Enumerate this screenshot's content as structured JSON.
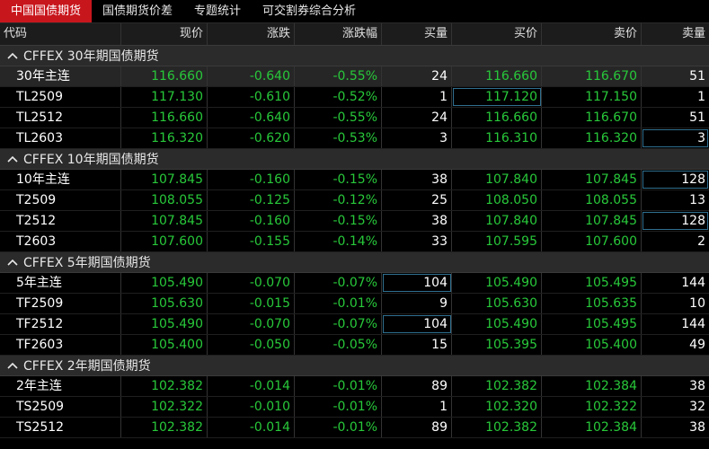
{
  "tabs": [
    "中国国债期货",
    "国债期货价差",
    "专题统计",
    "可交割券综合分析"
  ],
  "columns": [
    "代码",
    "现价",
    "涨跌",
    "涨跌幅",
    "买量",
    "买价",
    "卖价",
    "卖量"
  ],
  "groups": [
    {
      "title": "CFFEX 30年期国债期货",
      "rows": [
        {
          "code": "30年主连",
          "price": "116.660",
          "chg": "-0.640",
          "pct": "-0.55%",
          "bvol": "24",
          "bid": "116.660",
          "ask": "116.670",
          "avol": "51"
        },
        {
          "code": "TL2509",
          "price": "117.130",
          "chg": "-0.610",
          "pct": "-0.52%",
          "bvol": "1",
          "bid": "117.120",
          "ask": "117.150",
          "avol": "1"
        },
        {
          "code": "TL2512",
          "price": "116.660",
          "chg": "-0.640",
          "pct": "-0.55%",
          "bvol": "24",
          "bid": "116.660",
          "ask": "116.670",
          "avol": "51"
        },
        {
          "code": "TL2603",
          "price": "116.320",
          "chg": "-0.620",
          "pct": "-0.53%",
          "bvol": "3",
          "bid": "116.310",
          "ask": "116.320",
          "avol": "3"
        }
      ]
    },
    {
      "title": "CFFEX 10年期国债期货",
      "rows": [
        {
          "code": "10年主连",
          "price": "107.845",
          "chg": "-0.160",
          "pct": "-0.15%",
          "bvol": "38",
          "bid": "107.840",
          "ask": "107.845",
          "avol": "128"
        },
        {
          "code": "T2509",
          "price": "108.055",
          "chg": "-0.125",
          "pct": "-0.12%",
          "bvol": "25",
          "bid": "108.050",
          "ask": "108.055",
          "avol": "13"
        },
        {
          "code": "T2512",
          "price": "107.845",
          "chg": "-0.160",
          "pct": "-0.15%",
          "bvol": "38",
          "bid": "107.840",
          "ask": "107.845",
          "avol": "128"
        },
        {
          "code": "T2603",
          "price": "107.600",
          "chg": "-0.155",
          "pct": "-0.14%",
          "bvol": "33",
          "bid": "107.595",
          "ask": "107.600",
          "avol": "2"
        }
      ]
    },
    {
      "title": "CFFEX 5年期国债期货",
      "rows": [
        {
          "code": "5年主连",
          "price": "105.490",
          "chg": "-0.070",
          "pct": "-0.07%",
          "bvol": "104",
          "bid": "105.490",
          "ask": "105.495",
          "avol": "144"
        },
        {
          "code": "TF2509",
          "price": "105.630",
          "chg": "-0.015",
          "pct": "-0.01%",
          "bvol": "9",
          "bid": "105.630",
          "ask": "105.635",
          "avol": "10"
        },
        {
          "code": "TF2512",
          "price": "105.490",
          "chg": "-0.070",
          "pct": "-0.07%",
          "bvol": "104",
          "bid": "105.490",
          "ask": "105.495",
          "avol": "144"
        },
        {
          "code": "TF2603",
          "price": "105.400",
          "chg": "-0.050",
          "pct": "-0.05%",
          "bvol": "15",
          "bid": "105.395",
          "ask": "105.400",
          "avol": "49"
        }
      ]
    },
    {
      "title": "CFFEX 2年期国债期货",
      "rows": [
        {
          "code": "2年主连",
          "price": "102.382",
          "chg": "-0.014",
          "pct": "-0.01%",
          "bvol": "89",
          "bid": "102.382",
          "ask": "102.384",
          "avol": "38"
        },
        {
          "code": "TS2509",
          "price": "102.322",
          "chg": "-0.010",
          "pct": "-0.01%",
          "bvol": "1",
          "bid": "102.320",
          "ask": "102.322",
          "avol": "32"
        },
        {
          "code": "TS2512",
          "price": "102.382",
          "chg": "-0.014",
          "pct": "-0.01%",
          "bvol": "89",
          "bid": "102.382",
          "ask": "102.384",
          "avol": "38"
        }
      ]
    }
  ],
  "colors": {
    "active_tab": "#c8161d",
    "down": "#28c83a",
    "header_bg": "#1c1c1c",
    "group_bg": "#2b2b2b"
  },
  "icons": {
    "group_toggle": "chevron-up-icon"
  }
}
